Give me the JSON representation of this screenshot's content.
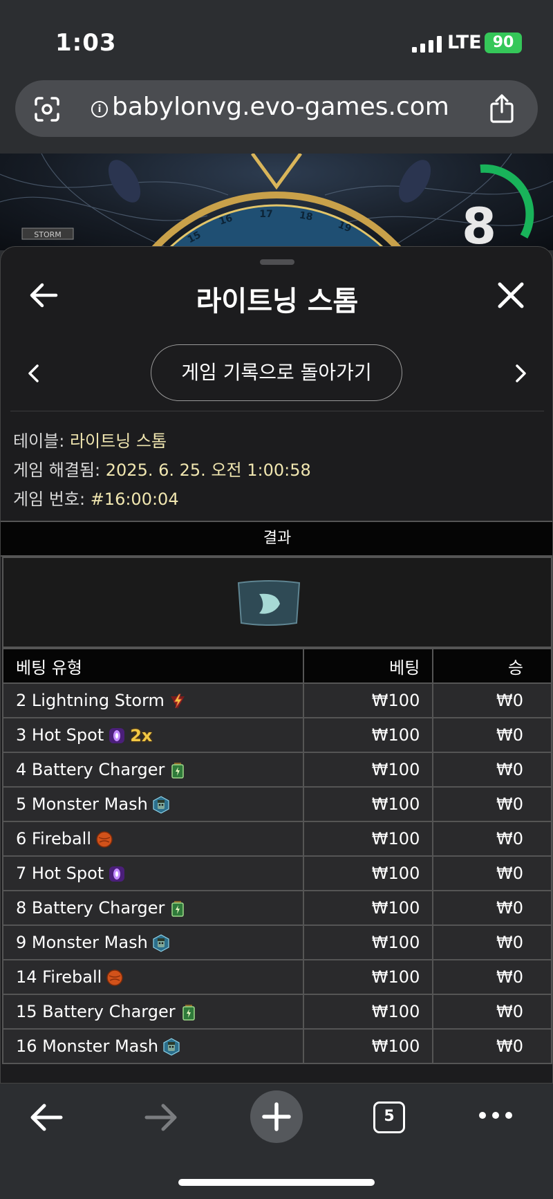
{
  "status_bar": {
    "time": "1:03",
    "network": "LTE",
    "battery": "90"
  },
  "browser": {
    "url": "babylonvg.evo-games.com"
  },
  "game": {
    "timer": "8"
  },
  "sheet": {
    "title": "라이트닝 스톰",
    "history_button": "게임 기록으로 돌아가기",
    "table_label": "테이블:",
    "table_value": "라이트닝 스톰",
    "resolved_label": "게임 해결됨:",
    "resolved_value": "2025. 6. 25. 오전 1:00:58",
    "game_no_label": "게임 번호:",
    "game_no_value": "#16:00:04",
    "result_header": "결과"
  },
  "bets_table": {
    "headers": {
      "type": "베팅 유형",
      "bet": "베팅",
      "win": "승"
    },
    "rows": [
      {
        "type": "2 Lightning Storm",
        "icon": "lightning-icon",
        "bet": "₩100",
        "win": "₩0"
      },
      {
        "type": "3 Hot Spot",
        "icon": "hot-spot-icon",
        "multiplier": "2x",
        "bet": "₩100",
        "win": "₩0"
      },
      {
        "type": "4 Battery Charger",
        "icon": "battery-icon",
        "bet": "₩100",
        "win": "₩0"
      },
      {
        "type": "5 Monster Mash",
        "icon": "monster-icon",
        "bet": "₩100",
        "win": "₩0"
      },
      {
        "type": "6 Fireball",
        "icon": "fireball-icon",
        "bet": "₩100",
        "win": "₩0"
      },
      {
        "type": "7 Hot Spot",
        "icon": "hot-spot-icon",
        "bet": "₩100",
        "win": "₩0"
      },
      {
        "type": "8 Battery Charger",
        "icon": "battery-icon",
        "bet": "₩100",
        "win": "₩0"
      },
      {
        "type": "9 Monster Mash",
        "icon": "monster-icon",
        "bet": "₩100",
        "win": "₩0"
      },
      {
        "type": "14 Fireball",
        "icon": "fireball-icon",
        "bet": "₩100",
        "win": "₩0"
      },
      {
        "type": "15 Battery Charger",
        "icon": "battery-icon",
        "bet": "₩100",
        "win": "₩0"
      },
      {
        "type": "16 Monster Mash",
        "icon": "monster-icon",
        "bet": "₩100",
        "win": "₩0"
      }
    ]
  },
  "toolbar": {
    "tab_count": "5"
  }
}
